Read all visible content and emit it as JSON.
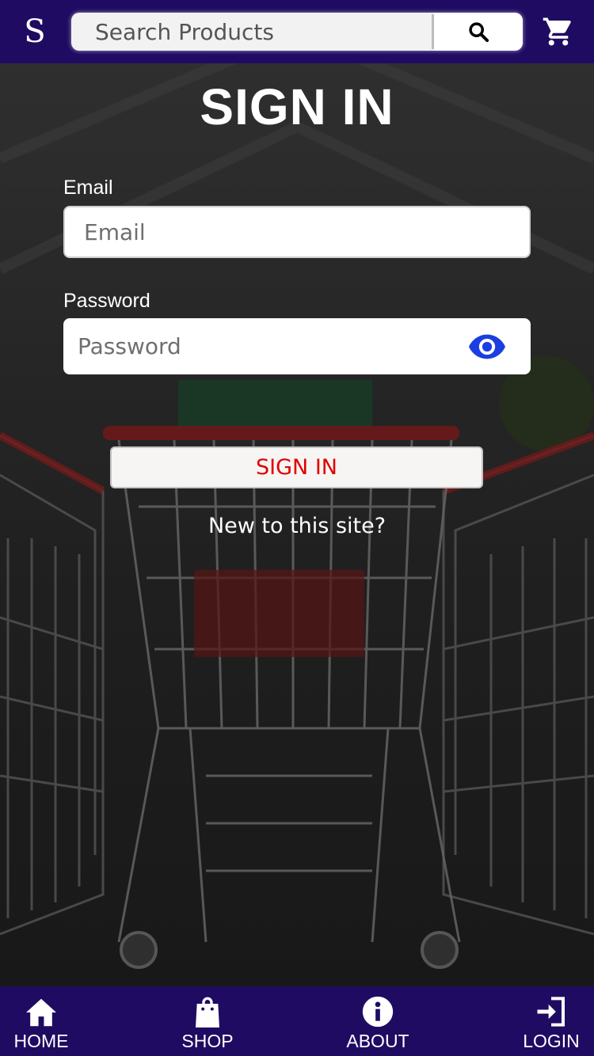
{
  "header": {
    "logo_text": "S",
    "search_placeholder": "Search Products",
    "search_icon": "search-icon",
    "cart_icon": "cart-icon"
  },
  "form": {
    "title": "SIGN IN",
    "email_label": "Email",
    "email_placeholder": "Email",
    "password_label": "Password",
    "password_placeholder": "Password",
    "password_toggle_icon": "eye-icon",
    "submit_label": "SIGN IN",
    "new_user_text": "New to this site?"
  },
  "bottom_nav": {
    "items": [
      {
        "label": "HOME",
        "icon": "home-icon"
      },
      {
        "label": "SHOP",
        "icon": "shopping-bag-icon"
      },
      {
        "label": "ABOUT",
        "icon": "info-icon"
      },
      {
        "label": "LOGIN",
        "icon": "login-icon"
      }
    ]
  },
  "colors": {
    "nav_background": "#1f0b62",
    "submit_text": "#e00000",
    "eye_icon": "#1a3fe0"
  }
}
